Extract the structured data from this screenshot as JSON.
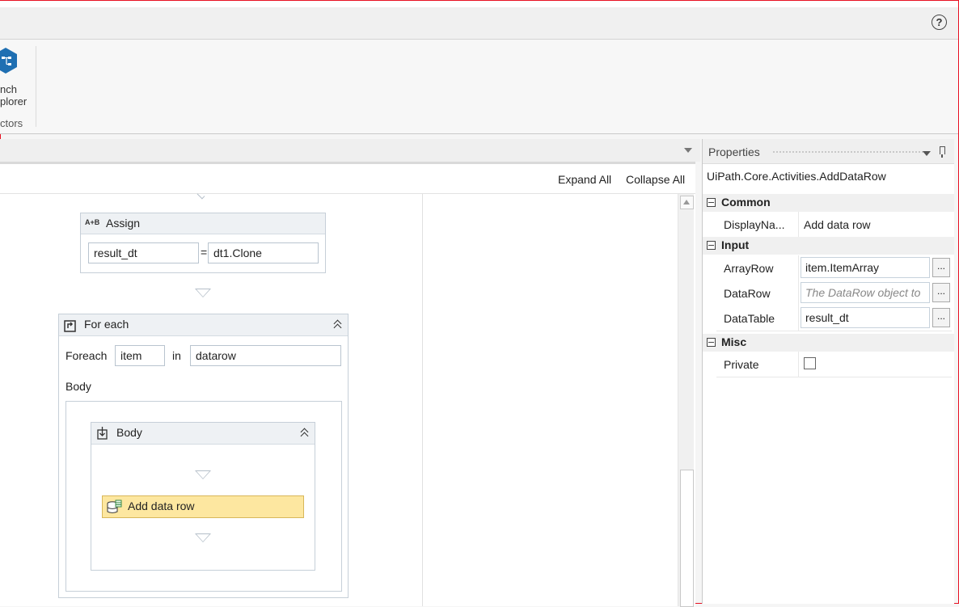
{
  "titlebar": {
    "help_glyph": "?"
  },
  "ribbon": {
    "button_label_line1": "nch",
    "button_label_line2": "plorer",
    "group_label": "ctors",
    "icon": "hexagon-tree-icon",
    "icon_color": "#1f6fb2"
  },
  "designer": {
    "expand_all": "Expand All",
    "collapse_all": "Collapse All",
    "assign": {
      "title": "Assign",
      "icon_text": "A+B",
      "to": "result_dt",
      "equals": "=",
      "value": "dt1.Clone"
    },
    "foreach": {
      "title": "For each",
      "foreach_label": "Foreach",
      "item": "item",
      "in_label": "in",
      "collection": "datarow",
      "body_label": "Body"
    },
    "body": {
      "title": "Body"
    },
    "add_data_row": {
      "label": "Add data row",
      "color": "#fde7a0"
    }
  },
  "properties": {
    "title": "Properties",
    "type_name": "UiPath.Core.Activities.AddDataRow",
    "categories": [
      {
        "name": "Common"
      },
      {
        "name": "Input"
      },
      {
        "name": "Misc"
      }
    ],
    "display_name": {
      "key": "DisplayNa...",
      "value": "Add data row"
    },
    "array_row": {
      "key": "ArrayRow",
      "value": "item.ItemArray"
    },
    "data_row": {
      "key": "DataRow",
      "placeholder": "The DataRow object to"
    },
    "data_table": {
      "key": "DataTable",
      "value": "result_dt"
    },
    "private": {
      "key": "Private",
      "checked": false
    },
    "ellipsis": "..."
  }
}
